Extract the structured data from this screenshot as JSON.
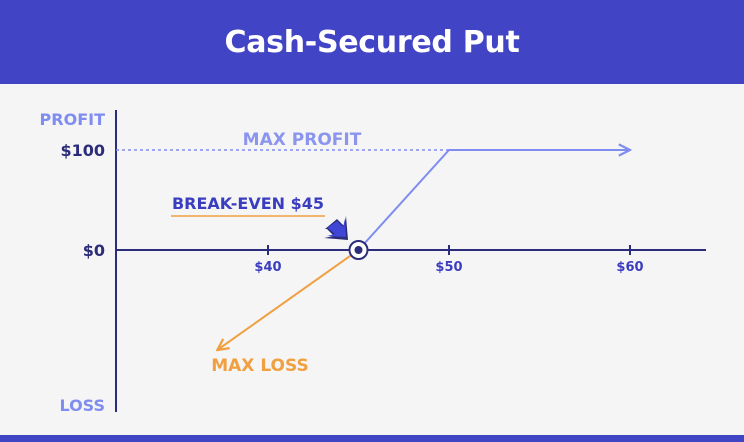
{
  "title": "Cash-Secured Put",
  "colors": {
    "header_bg": "#4244c6",
    "axis": "#2b2d7a",
    "axis_label": "#7f8cf0",
    "profit_line": "#7f8cf0",
    "loss_line": "#f0a040",
    "breakeven_text": "#3b3dc0",
    "breakeven_underline": "#f0a040"
  },
  "chart_data": {
    "type": "line",
    "title": "Cash-Secured Put",
    "x_ticks": [
      "$40",
      "$50",
      "$60"
    ],
    "x_tick_values": [
      40,
      50,
      60
    ],
    "y_ticks": [
      "$100",
      "$0"
    ],
    "y_tick_values": [
      100,
      0
    ],
    "y_top_label": "PROFIT",
    "y_bottom_label": "LOSS",
    "xlim": [
      32.5,
      64
    ],
    "ylim": [
      -160,
      140
    ],
    "max_profit_level": 100,
    "profit_segment": [
      {
        "x": 45,
        "y": 0
      },
      {
        "x": 50,
        "y": 100
      },
      {
        "x": 60,
        "y": 100
      }
    ],
    "loss_segment": [
      {
        "x": 45,
        "y": 0
      },
      {
        "x": 37.2,
        "y": -100
      }
    ],
    "breakeven": {
      "x": 45,
      "y": 0
    },
    "annotations": {
      "max_profit": "MAX PROFIT",
      "max_loss": "MAX LOSS",
      "breakeven": "BREAK-EVEN $45"
    }
  }
}
